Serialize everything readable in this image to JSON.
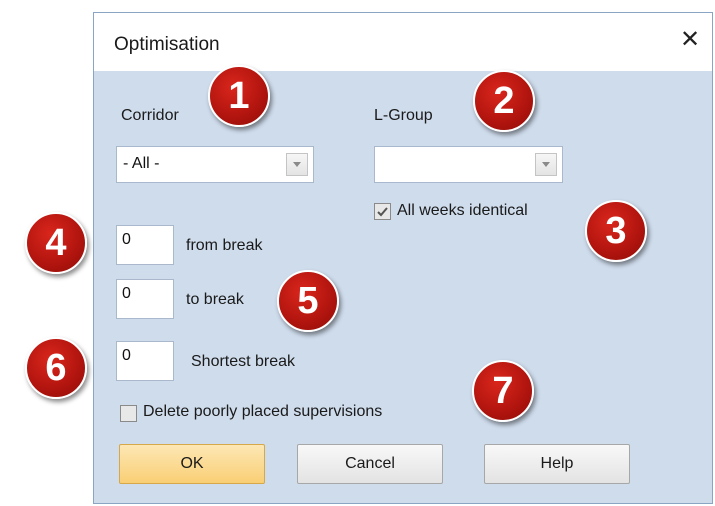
{
  "dialog": {
    "title": "Optimisation",
    "close_glyph": "✕"
  },
  "corridor": {
    "label": "Corridor",
    "value": "- All -"
  },
  "lgroup": {
    "label": "L-Group",
    "value": ""
  },
  "all_weeks": {
    "label": "All weeks identical",
    "checked": true
  },
  "from_break": {
    "value": "0",
    "label": "from break"
  },
  "to_break": {
    "value": "0",
    "label": "to break"
  },
  "shortest_break": {
    "value": "0",
    "label": "Shortest break"
  },
  "delete_poorly": {
    "label": "Delete poorly placed supervisions",
    "checked": false
  },
  "buttons": {
    "ok": "OK",
    "cancel": "Cancel",
    "help": "Help"
  },
  "markers": [
    "1",
    "2",
    "3",
    "4",
    "5",
    "6",
    "7"
  ],
  "colors": {
    "dialog_bg": "#cfdcec",
    "marker": "#c01a12",
    "ok_button": "#fbd98a"
  }
}
